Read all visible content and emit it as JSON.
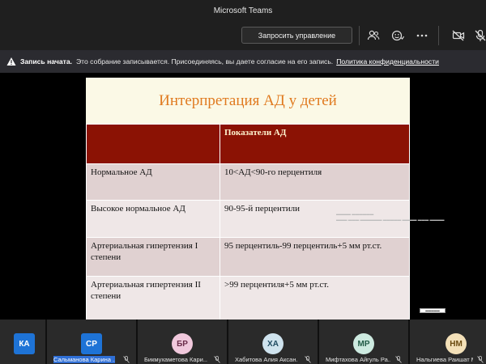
{
  "window": {
    "title": "Microsoft Teams"
  },
  "toolbar": {
    "request_control_label": "Запросить управление",
    "icons": [
      "people-icon",
      "reactions-icon",
      "more-icon",
      "camera-off-icon",
      "mic-off-icon"
    ]
  },
  "banner": {
    "bold": "Запись начата.",
    "text": "Это собрание записывается. Присоединяясь, вы даете согласие на его запись.",
    "link": "Политика конфиденциальности"
  },
  "slide": {
    "title": "Интерпретация АД у детей",
    "header": [
      "",
      "Показатели АД"
    ],
    "rows": [
      [
        "Нормальное АД",
        "10<АД<90-го перцентиля"
      ],
      [
        "Высокое нормальное АД",
        "90-95-й перцентили"
      ],
      [
        "Артериальная гипертензия I степени",
        "95 перцентиль-99 перцентиль+5 мм рт.ст."
      ],
      [
        "Артериальная гипертензия II степени",
        ">99 перцентиля+5 мм рт.ст."
      ]
    ]
  },
  "participants": [
    {
      "initials": "КА",
      "name": "",
      "color": "#1e73d6",
      "text_color": "#ffffff",
      "square": true
    },
    {
      "initials": "СР",
      "name": "Сальманова Карина ...",
      "color": "#1e73d6",
      "text_color": "#ffffff",
      "square": true
    },
    {
      "initials": "БР",
      "name": "Бикмухаметова Кари...",
      "color": "#f0c8dc",
      "text_color": "#6a2d4a"
    },
    {
      "initials": "ХА",
      "name": "Хабитова Алия Аксан...",
      "color": "#cfe3ee",
      "text_color": "#1e4a60"
    },
    {
      "initials": "МР",
      "name": "Мифтахова Айгуль Ра...",
      "color": "#cdeae0",
      "text_color": "#205a45"
    },
    {
      "initials": "НМ",
      "name": "Нальгиева Раишат М...",
      "color": "#f3e0b8",
      "text_color": "#6a4a10"
    }
  ]
}
